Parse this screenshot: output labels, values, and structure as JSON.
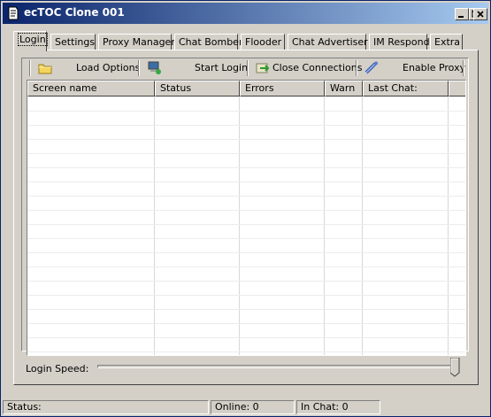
{
  "window": {
    "title": "ecTOC Clone 001"
  },
  "tabs": [
    {
      "label": "Login"
    },
    {
      "label": "Settings"
    },
    {
      "label": "Proxy Manager"
    },
    {
      "label": "Chat Bomber"
    },
    {
      "label": "Flooder"
    },
    {
      "label": "Chat Advertiser"
    },
    {
      "label": "IM Respond"
    },
    {
      "label": "Extra"
    }
  ],
  "active_tab": "Login",
  "toolbar": {
    "load_options": "Load Options",
    "start_login": "Start Login",
    "close_connections": "Close Connections",
    "enable_proxy": "Enable Proxy"
  },
  "list": {
    "columns": [
      "Screen name",
      "Status",
      "Errors",
      "Warn",
      "Last Chat:"
    ],
    "rows": []
  },
  "login_speed": {
    "label": "Login Speed:",
    "value": 1.0
  },
  "status": {
    "status_label": "Status:",
    "online_label": "Online: 0",
    "in_chat_label": "In Chat: 0"
  },
  "icons": {
    "title": "app-icon",
    "load_options": "folder-icon",
    "start_login": "computer-icon",
    "close_connections": "close-connections-icon",
    "enable_proxy": "proxy-icon"
  }
}
